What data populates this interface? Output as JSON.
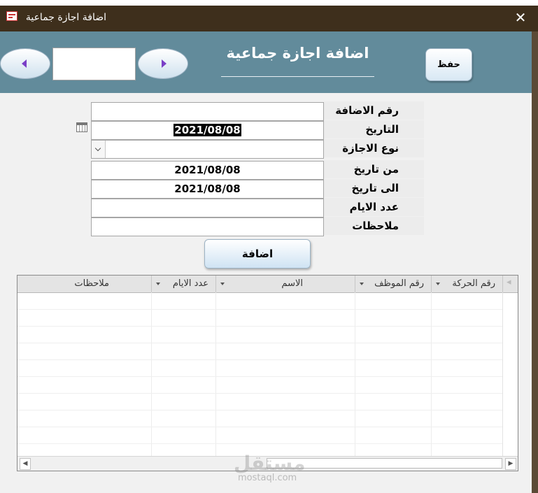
{
  "window": {
    "title": "اضافة اجازة جماعية",
    "close_glyph": "✕",
    "app_icon": "form-icon"
  },
  "header": {
    "form_title": "اضافة اجازة جماعية",
    "save_label": "حفظ",
    "nav_value": ""
  },
  "form": {
    "labels": {
      "add_number": "رقم الاضافة",
      "date": "التاريخ",
      "leave_type": "نوع الاجازة",
      "from_date": "من تاريخ",
      "to_date": "الى تاريخ",
      "days_count": "عدد الايام",
      "notes": "ملاحظات"
    },
    "values": {
      "add_number": "",
      "date": "2021/08/08",
      "leave_type": "",
      "from_date": "2021/08/08",
      "to_date": "2021/08/08",
      "days_count": "",
      "notes": ""
    },
    "add_button": "اضافة"
  },
  "grid": {
    "columns": [
      "رقم الحركة",
      "رقم الموظف",
      "الاسم",
      "عدد الايام",
      "ملاحظات"
    ],
    "rows": []
  },
  "watermark": {
    "main": "مستقل",
    "sub": "mostaql.com"
  },
  "colors": {
    "titlebar": "#3e2f1c",
    "header": "#628b9b",
    "nav_arrow": "#7a3fc7"
  }
}
